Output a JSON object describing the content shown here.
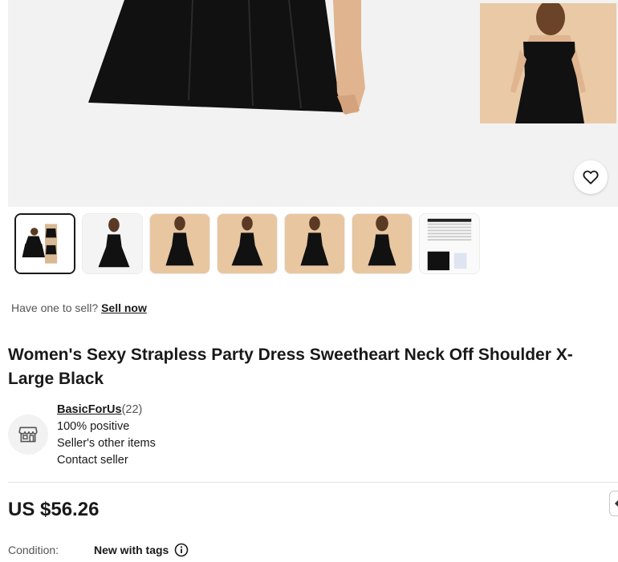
{
  "gallery": {
    "main_image": "black-strapless-dress-photo",
    "side_image": "model-in-dress-photo",
    "favorite_icon": "heart-icon",
    "thumbnails": [
      {
        "icon": "dress-collage-thumbnail",
        "selected": true
      },
      {
        "icon": "dress-front-thumbnail",
        "selected": false
      },
      {
        "icon": "dress-front-thumbnail",
        "selected": false
      },
      {
        "icon": "dress-front-thumbnail",
        "selected": false
      },
      {
        "icon": "dress-front-thumbnail",
        "selected": false
      },
      {
        "icon": "dress-back-thumbnail",
        "selected": false
      },
      {
        "icon": "size-chart-thumbnail",
        "selected": false
      }
    ]
  },
  "sell": {
    "prompt": "Have one to sell?",
    "link": "Sell now"
  },
  "product": {
    "title": "Women's Sexy Strapless Party Dress Sweetheart Neck Off Shoulder X-Large Black"
  },
  "seller": {
    "icon": "store-icon",
    "name": "BasicForUs",
    "feedback_count": "(22)",
    "positive": "100% positive",
    "other_items": "Seller's other items",
    "contact": "Contact seller"
  },
  "price": {
    "value": "US $56.26"
  },
  "condition": {
    "label": "Condition:",
    "value": "New with tags",
    "info_icon": "info-icon"
  },
  "colors": {
    "text": "#191919",
    "muted": "#555555",
    "background": "#f2f2f2",
    "dress": "#111111",
    "skin": "#e0b48f"
  }
}
